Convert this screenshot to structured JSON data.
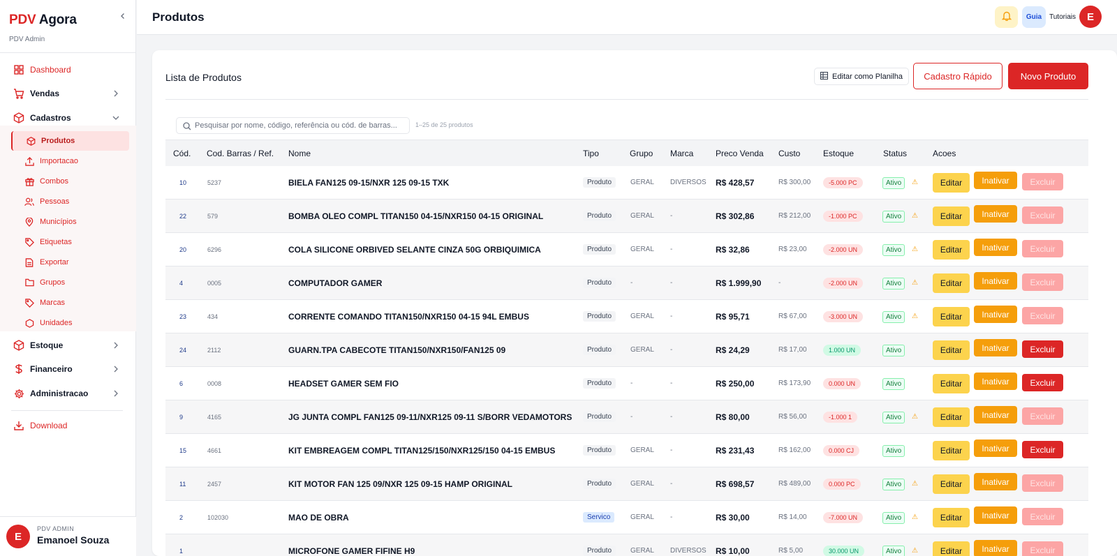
{
  "sidebar": {
    "brand_pdv": "PDV",
    "brand_agora": "Agora",
    "subtitle": "PDV Admin",
    "nav": {
      "dashboard": "Dashboard",
      "vendas": "Vendas",
      "cadastros": "Cadastros",
      "estoque": "Estoque",
      "financeiro": "Financeiro",
      "administracao": "Administracao",
      "download": "Download"
    },
    "sub": {
      "produtos": "Produtos",
      "importacao": "Importacao",
      "combos": "Combos",
      "pessoas": "Pessoas",
      "municipios": "Municípios",
      "etiquetas": "Etiquetas",
      "exportar": "Exportar",
      "grupos": "Grupos",
      "marcas": "Marcas",
      "unidades": "Unidades"
    },
    "user": {
      "initial": "E",
      "role": "PDV ADMIN",
      "name": "Emanoel Souza"
    }
  },
  "header": {
    "title": "Produtos",
    "guia": "Guia",
    "tutoriais": "Tutoriais",
    "avatar": "E"
  },
  "card": {
    "title": "Lista de Produtos",
    "btn_planilha": "Editar como Planilha",
    "btn_rapido": "Cadastro Rápido",
    "btn_novo": "Novo Produto",
    "search_placeholder": "Pesquisar por nome, código, referência ou cód. de barras...",
    "count": "1–25 de 25 produtos"
  },
  "table": {
    "headers": {
      "cod": "Cód.",
      "ref": "Cod. Barras / Ref.",
      "nome": "Nome",
      "tipo": "Tipo",
      "grupo": "Grupo",
      "marca": "Marca",
      "preco": "Preco Venda",
      "custo": "Custo",
      "estoque": "Estoque",
      "status": "Status",
      "acoes": "Acoes"
    },
    "labels": {
      "editar": "Editar",
      "inativar": "Inativar",
      "excluir": "Excluir",
      "warn": "⚠"
    },
    "rows": [
      {
        "cod": "10",
        "ref": "5237",
        "nome": "BIELA FAN125 09-15/NXR 125 09-15 TXK",
        "tipo": "Produto",
        "grupo": "GERAL",
        "marca": "DIVERSOS",
        "preco": "R$ 428,57",
        "custo": "R$ 300,00",
        "estoque": "-5.000 PC",
        "stock_neg": true,
        "status": "Ativo",
        "warn": true,
        "excluir_enabled": false
      },
      {
        "cod": "22",
        "ref": "579",
        "nome": "BOMBA OLEO COMPL TITAN150 04-15/NXR150 04-15 ORIGINAL",
        "tipo": "Produto",
        "grupo": "GERAL",
        "marca": "-",
        "preco": "R$ 302,86",
        "custo": "R$ 212,00",
        "estoque": "-1.000 PC",
        "stock_neg": true,
        "status": "Ativo",
        "warn": true,
        "excluir_enabled": false
      },
      {
        "cod": "20",
        "ref": "6296",
        "nome": "COLA SILICONE ORBIVED SELANTE CINZA 50G ORBIQUIMICA",
        "tipo": "Produto",
        "grupo": "GERAL",
        "marca": "-",
        "preco": "R$ 32,86",
        "custo": "R$ 23,00",
        "estoque": "-2.000 UN",
        "stock_neg": true,
        "status": "Ativo",
        "warn": true,
        "excluir_enabled": false
      },
      {
        "cod": "4",
        "ref": "0005",
        "nome": "COMPUTADOR GAMER",
        "tipo": "Produto",
        "grupo": "-",
        "marca": "-",
        "preco": "R$ 1.999,90",
        "custo": "-",
        "estoque": "-2.000 UN",
        "stock_neg": true,
        "status": "Ativo",
        "warn": true,
        "excluir_enabled": false
      },
      {
        "cod": "23",
        "ref": "434",
        "nome": "CORRENTE COMANDO TITAN150/NXR150 04-15 94L EMBUS",
        "tipo": "Produto",
        "grupo": "GERAL",
        "marca": "-",
        "preco": "R$ 95,71",
        "custo": "R$ 67,00",
        "estoque": "-3.000 UN",
        "stock_neg": true,
        "status": "Ativo",
        "warn": true,
        "excluir_enabled": false
      },
      {
        "cod": "24",
        "ref": "2112",
        "nome": "GUARN.TPA CABECOTE TITAN150/NXR150/FAN125 09",
        "tipo": "Produto",
        "grupo": "GERAL",
        "marca": "-",
        "preco": "R$ 24,29",
        "custo": "R$ 17,00",
        "estoque": "1.000 UN",
        "stock_neg": false,
        "status": "Ativo",
        "warn": false,
        "excluir_enabled": true
      },
      {
        "cod": "6",
        "ref": "0008",
        "nome": "HEADSET GAMER SEM FIO",
        "tipo": "Produto",
        "grupo": "-",
        "marca": "-",
        "preco": "R$ 250,00",
        "custo": "R$ 173,90",
        "estoque": "0.000 UN",
        "stock_neg": true,
        "status": "Ativo",
        "warn": false,
        "excluir_enabled": true
      },
      {
        "cod": "9",
        "ref": "4165",
        "nome": "JG JUNTA COMPL FAN125 09-11/NXR125 09-11 S/BORR VEDAMOTORS",
        "tipo": "Produto",
        "grupo": "-",
        "marca": "-",
        "preco": "R$ 80,00",
        "custo": "R$ 56,00",
        "estoque": "-1.000 1",
        "stock_neg": true,
        "status": "Ativo",
        "warn": true,
        "excluir_enabled": false
      },
      {
        "cod": "15",
        "ref": "4661",
        "nome": "KIT EMBREAGEM COMPL TITAN125/150/NXR125/150 04-15 EMBUS",
        "tipo": "Produto",
        "grupo": "GERAL",
        "marca": "-",
        "preco": "R$ 231,43",
        "custo": "R$ 162,00",
        "estoque": "0.000 CJ",
        "stock_neg": true,
        "status": "Ativo",
        "warn": false,
        "excluir_enabled": true
      },
      {
        "cod": "11",
        "ref": "2457",
        "nome": "KIT MOTOR FAN 125 09/NXR 125 09-15 HAMP ORIGINAL",
        "tipo": "Produto",
        "grupo": "GERAL",
        "marca": "-",
        "preco": "R$ 698,57",
        "custo": "R$ 489,00",
        "estoque": "0.000 PC",
        "stock_neg": true,
        "status": "Ativo",
        "warn": true,
        "excluir_enabled": false
      },
      {
        "cod": "2",
        "ref": "102030",
        "nome": "MAO DE OBRA",
        "tipo": "Servico",
        "grupo": "GERAL",
        "marca": "-",
        "preco": "R$ 30,00",
        "custo": "R$ 14,00",
        "estoque": "-7.000 UN",
        "stock_neg": true,
        "status": "Ativo",
        "warn": true,
        "excluir_enabled": false
      },
      {
        "cod": "1",
        "ref": "",
        "nome": "MICROFONE GAMER FIFINE H9",
        "tipo": "Produto",
        "grupo": "GERAL",
        "marca": "DIVERSOS",
        "preco": "R$ 10,00",
        "custo": "R$ 5,00",
        "estoque": "30.000 UN",
        "stock_neg": false,
        "status": "Ativo",
        "warn": true,
        "excluir_enabled": false
      }
    ]
  }
}
